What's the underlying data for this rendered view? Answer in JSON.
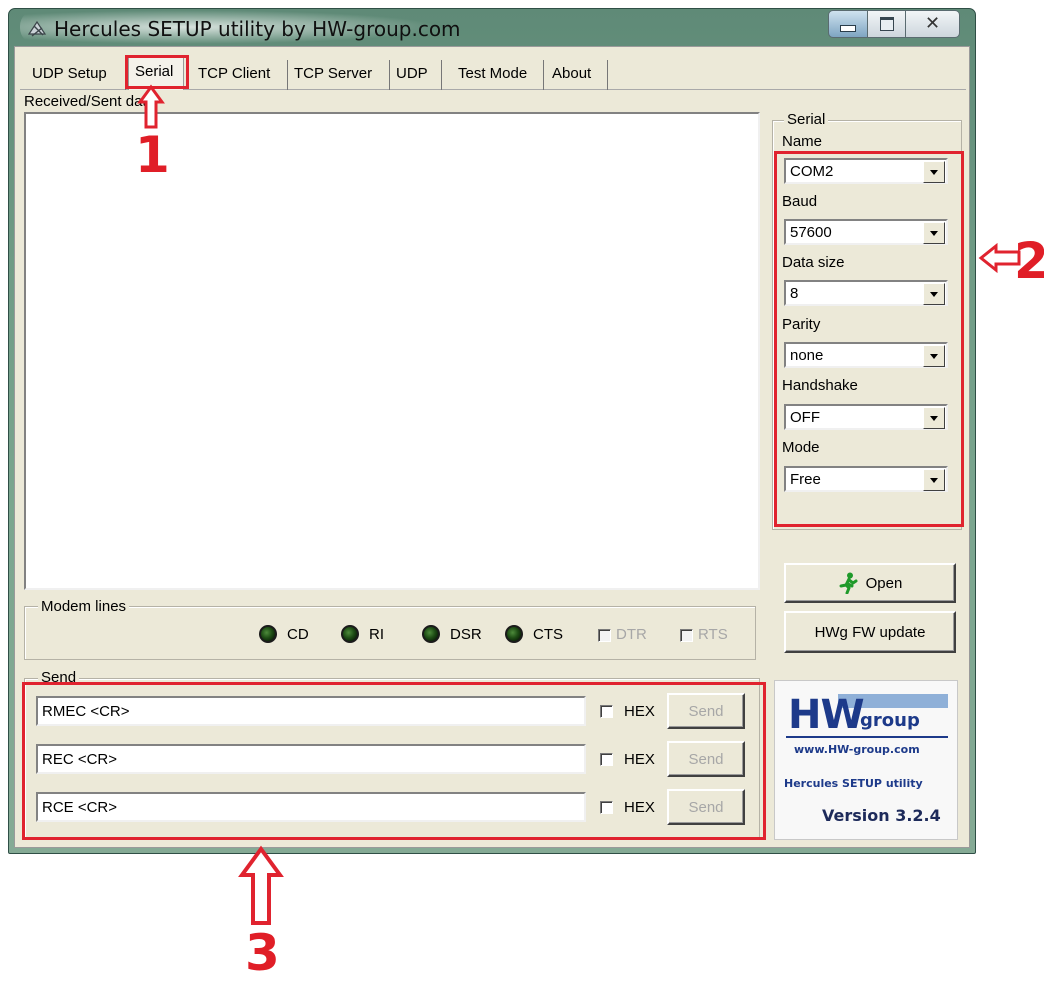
{
  "window": {
    "title": "Hercules SETUP utility by HW-group.com",
    "close_glyph": "✕"
  },
  "tabs": [
    {
      "label": "UDP Setup"
    },
    {
      "label": "Serial",
      "active": true
    },
    {
      "label": "TCP Client"
    },
    {
      "label": "TCP Server"
    },
    {
      "label": "UDP"
    },
    {
      "label": "Test Mode"
    },
    {
      "label": "About"
    }
  ],
  "received": {
    "label": "Received/Sent data"
  },
  "modem": {
    "title": "Modem lines",
    "leds": [
      "CD",
      "RI",
      "DSR",
      "CTS"
    ],
    "checks": [
      "DTR",
      "RTS"
    ]
  },
  "serial": {
    "title": "Serial",
    "fields": [
      {
        "label": "Name",
        "value": "COM2"
      },
      {
        "label": "Baud",
        "value": "57600"
      },
      {
        "label": "Data size",
        "value": "8"
      },
      {
        "label": "Parity",
        "value": "none"
      },
      {
        "label": "Handshake",
        "value": "OFF"
      },
      {
        "label": "Mode",
        "value": "Free"
      }
    ],
    "open_label": "Open",
    "fw_label": "HWg FW update"
  },
  "send": {
    "title": "Send",
    "rows": [
      {
        "value": "RMEC <CR>",
        "hex_label": "HEX",
        "button_label": "Send"
      },
      {
        "value": "REC <CR>",
        "hex_label": "HEX",
        "button_label": "Send"
      },
      {
        "value": "RCE <CR>",
        "hex_label": "HEX",
        "button_label": "Send"
      }
    ]
  },
  "logo": {
    "hw": "HW",
    "group": "group",
    "url": "www.HW-group.com",
    "product": "Hercules SETUP utility",
    "version": "Version  3.2.4"
  },
  "annotations": {
    "one": "1",
    "two": "2",
    "three": "3"
  },
  "colors": {
    "annotation_red": "#e0232f",
    "led_green": "#2e6b22",
    "logo_blue": "#1d3a8a"
  }
}
